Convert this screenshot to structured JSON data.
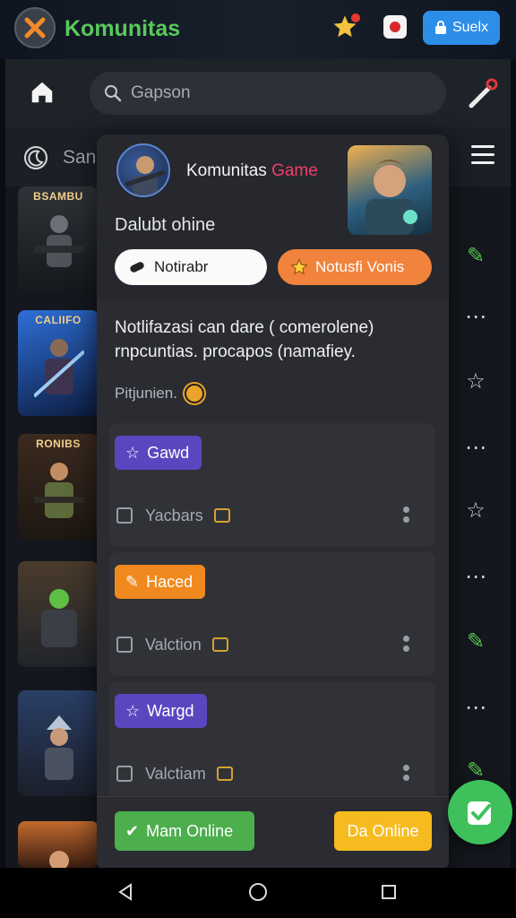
{
  "app": {
    "title": "Komunitas",
    "top_button_label": "Suelx"
  },
  "search": {
    "placeholder": "Gapson"
  },
  "list_header": {
    "label": "San"
  },
  "games": [
    {
      "caption": "BSAMBU"
    },
    {
      "caption": "CALIIFO"
    },
    {
      "caption": "RONIBS"
    },
    {
      "caption": ""
    },
    {
      "caption": ""
    },
    {
      "caption": ""
    }
  ],
  "popup": {
    "title_main": "Komunitas",
    "title_accent": "Game",
    "subtitle": "Dalubt ohine",
    "btn_notify": "Notirabr",
    "btn_notify_vonis": "Notusfi Vonis",
    "message": "Notlifazasi can dare ( comerolene) rnpcuntias. procapos (namafiey.",
    "small_note": "Pitjunien.",
    "sections": [
      {
        "tag": "Gawd",
        "row": "Yacbars"
      },
      {
        "tag": "Haced",
        "row": "Valction"
      },
      {
        "tag": "Wargd",
        "row": "Valctiam"
      }
    ],
    "btn_online": "Mam Online",
    "btn_da_online": "Da Online"
  },
  "colors": {
    "accent_green": "#58c95b",
    "accent_pink": "#ef3f6a",
    "tag_purple": "#5c46c0",
    "tag_orange": "#f08a1f",
    "btn_green": "#4cae4c",
    "btn_yellow": "#f6bb1f",
    "top_button_blue": "#2d8ee8"
  }
}
